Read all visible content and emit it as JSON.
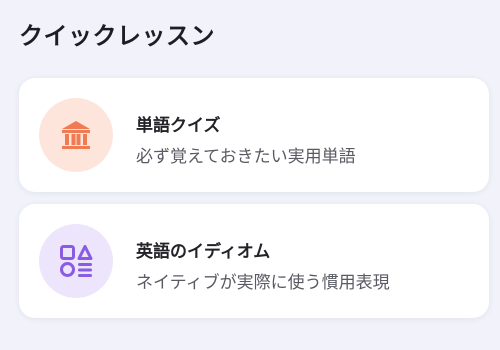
{
  "section": {
    "title": "クイックレッスン"
  },
  "lessons": [
    {
      "title": "単語クイズ",
      "subtitle": "必ず覚えておきたい実用単語",
      "icon": "bank-icon",
      "icon_color": "#f07a52",
      "icon_bg": "#fde5dc"
    },
    {
      "title": "英語のイディオム",
      "subtitle": "ネイティブが実際に使う慣用表現",
      "icon": "shapes-icon",
      "icon_color": "#8a5ce3",
      "icon_bg": "#ece5fb"
    }
  ]
}
